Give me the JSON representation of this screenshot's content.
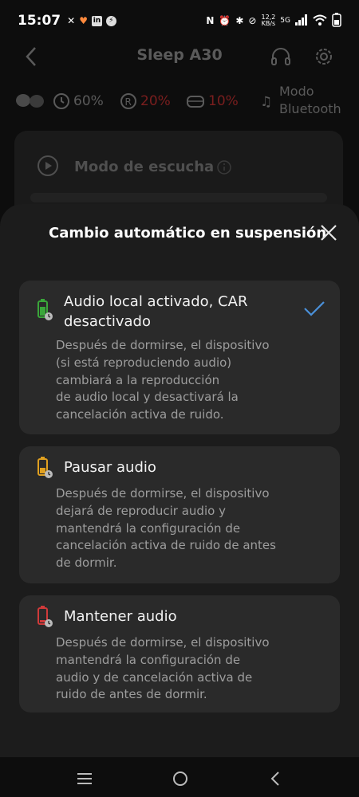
{
  "status_bar": {
    "time": "15:07",
    "network_speed": "12,2",
    "network_unit": "KB/s",
    "network_type": "5G"
  },
  "header": {
    "title": "Sleep A30"
  },
  "device_status": {
    "case_battery": "60%",
    "right_battery": "20%",
    "case_label_battery": "10%",
    "mode_line1": "Modo",
    "mode_line2": "Bluetooth"
  },
  "listen_card": {
    "label": "Modo de escucha"
  },
  "sheet": {
    "title": "Cambio automático en suspensión",
    "options": [
      {
        "title_line1": "Audio local activado, CAR",
        "title_line2": "desactivado",
        "desc": [
          "Después de dormirse, el dispositivo",
          "(si está reproduciendo audio)",
          "cambiará a la reproducción",
          "de audio local y desactivará la",
          "cancelación activa de ruido."
        ],
        "selected": true,
        "icon_color": "#3aa63a"
      },
      {
        "title_line1": "Pausar audio",
        "desc": [
          "Después de dormirse, el dispositivo",
          "dejará de reproducir audio y",
          "mantendrá la configuración de",
          "cancelación activa de ruido de antes",
          "de dormir."
        ],
        "selected": false,
        "icon_color": "#e0a020"
      },
      {
        "title_line1": "Mantener audio",
        "desc": [
          "Después de dormirse, el dispositivo",
          "mantendrá la configuración de",
          "audio y de cancelación activa de",
          "ruido de antes de dormir."
        ],
        "selected": false,
        "icon_color": "#d03a3a"
      }
    ]
  },
  "colors": {
    "accent_check": "#4a90d9",
    "sheet_bg": "#1c1c1c",
    "card_bg": "#2a2a2a"
  }
}
